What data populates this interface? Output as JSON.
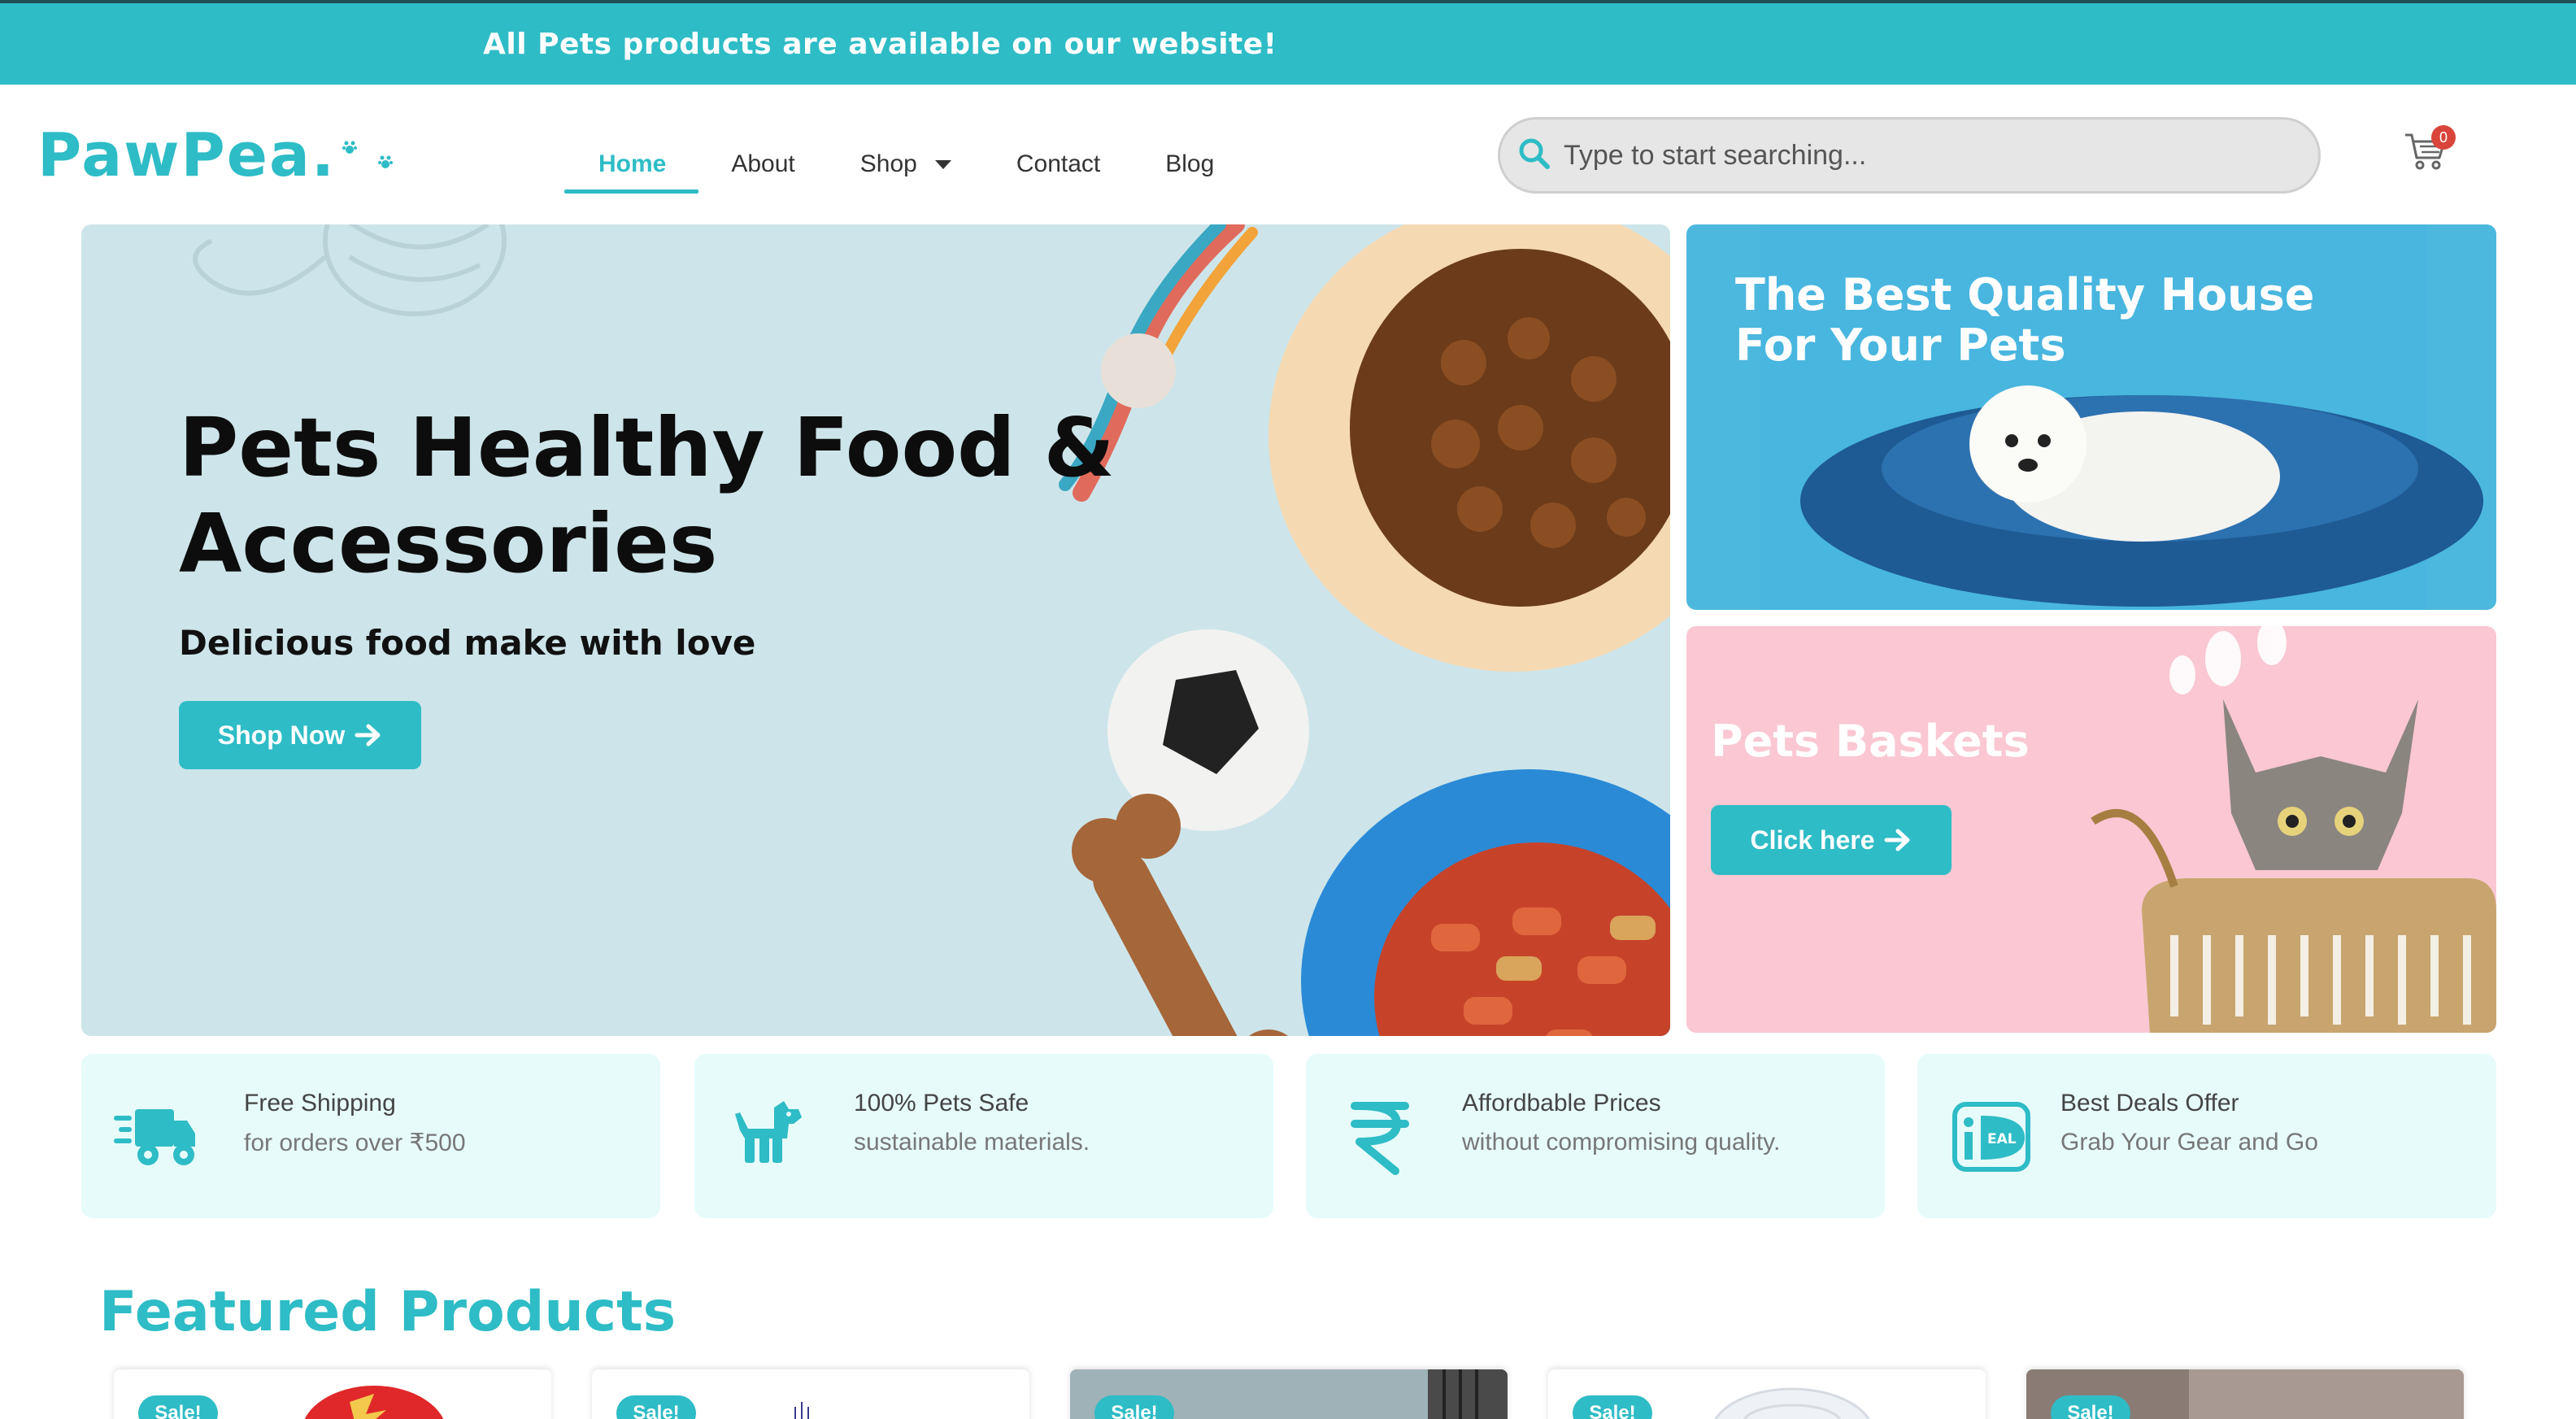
{
  "announcement": "All Pets products are available on our website!",
  "logo": {
    "text": "PawPea."
  },
  "nav": {
    "home": "Home",
    "about": "About",
    "shop": "Shop",
    "contact": "Contact",
    "blog": "Blog",
    "active": "Home"
  },
  "search": {
    "placeholder": "Type to start searching..."
  },
  "cart": {
    "count": "0"
  },
  "hero": {
    "title_line1": "Pets Healthy Food &",
    "title_line2": "Accessories",
    "subtitle": "Delicious food make with love",
    "button": "Shop Now"
  },
  "promo_house": {
    "title": "The Best Quality House For Your Pets"
  },
  "promo_basket": {
    "title": "Pets Baskets",
    "button": "Click here"
  },
  "features": [
    {
      "title": "Free Shipping",
      "desc": "for orders over  ₹500",
      "icon": "delivery-truck-icon"
    },
    {
      "title": "100% Pets Safe",
      "desc": "sustainable materials.",
      "icon": "dog-icon"
    },
    {
      "title": "Affordbable Prices",
      "desc": "without compromising quality.",
      "icon": "rupee-icon"
    },
    {
      "title": "Best Deals Offer",
      "desc": "Grab Your Gear and Go",
      "icon": "ideal-icon"
    }
  ],
  "featured": {
    "title": "Featured Products",
    "sale_label": "Sale!"
  },
  "colors": {
    "accent": "#2ebcc6",
    "badge": "#d9453b",
    "feature_bg": "#e7fbfb",
    "pink": "#fac7d3",
    "blue": "#4db8dd"
  }
}
